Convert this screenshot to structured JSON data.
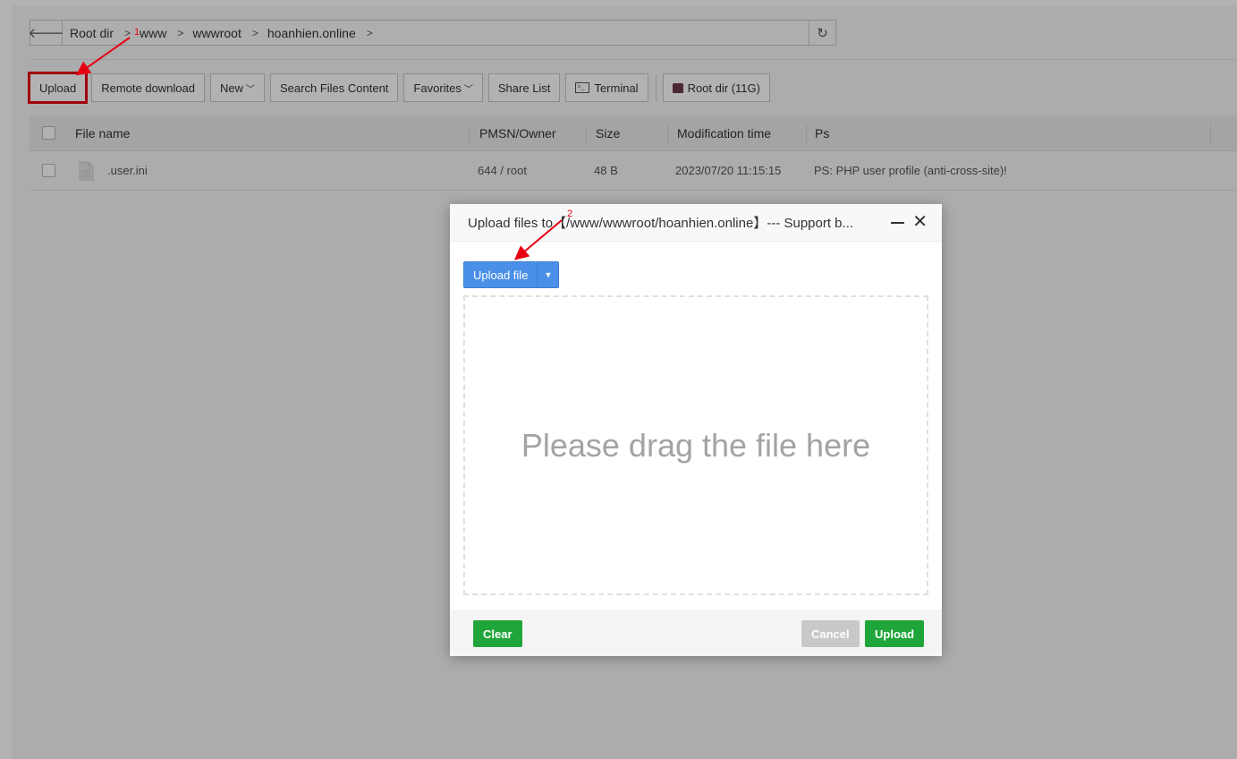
{
  "pathbar": {
    "back_icon": "arrow-left-icon",
    "crumbs": [
      "Root dir",
      "www",
      "wwwroot",
      "hoanhien.online"
    ],
    "refresh_icon": "refresh-icon"
  },
  "toolbar": {
    "upload": "Upload",
    "remote_download": "Remote download",
    "new": "New",
    "search": "Search Files Content",
    "favorites": "Favorites",
    "share_list": "Share List",
    "terminal": "Terminal",
    "root_dir": "Root dir (11G)"
  },
  "table": {
    "headers": [
      "File name",
      "PMSN/Owner",
      "Size",
      "Modification time",
      "Ps"
    ],
    "rows": [
      {
        "name": ".user.ini",
        "owner": "644 / root",
        "size": "48 B",
        "mtime": "2023/07/20 11:15:15",
        "ps": "PS: PHP user profile (anti-cross-site)!"
      }
    ]
  },
  "dialog": {
    "title": "Upload files to【/www/wwwroot/hoanhien.online】--- Support b...",
    "upload_file": "Upload file",
    "drop_text": "Please drag the file here",
    "clear": "Clear",
    "cancel": "Cancel",
    "upload": "Upload"
  },
  "annotations": [
    "1",
    "2"
  ],
  "colors": {
    "accent_blue": "#4a90e8",
    "green": "#20a53a",
    "annotation_red": "#e60012"
  }
}
